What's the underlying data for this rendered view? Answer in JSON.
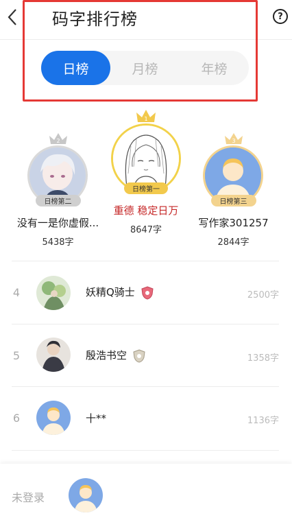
{
  "header": {
    "title": "码字排行榜",
    "help_label": "?"
  },
  "tabs": [
    {
      "label": "日榜",
      "active": true
    },
    {
      "label": "月榜",
      "active": false
    },
    {
      "label": "年榜",
      "active": false
    }
  ],
  "podium": {
    "second": {
      "rank": "2",
      "badge": "日榜第二",
      "name": "没有一是你虚假...",
      "count": "5438字"
    },
    "first": {
      "rank": "1",
      "badge": "日榜第一",
      "name": "重德 稳定日万",
      "count": "8647字"
    },
    "third": {
      "rank": "3",
      "badge": "日榜第三",
      "name": "写作家301257",
      "count": "2844字"
    }
  },
  "list": [
    {
      "rank": "4",
      "name": "妖精Q骑士",
      "count": "2500字"
    },
    {
      "rank": "5",
      "name": "殷浩书空",
      "count": "1358字"
    },
    {
      "rank": "6",
      "name": "十**",
      "count": "1136字"
    }
  ],
  "footer": {
    "label": "未登录"
  },
  "colors": {
    "accent": "#1a73e8",
    "annotation": "#e53935",
    "gold": "#f2c94c",
    "silver": "#c7c7c7",
    "bronze": "#f3d38e",
    "first_name": "#c62828"
  }
}
